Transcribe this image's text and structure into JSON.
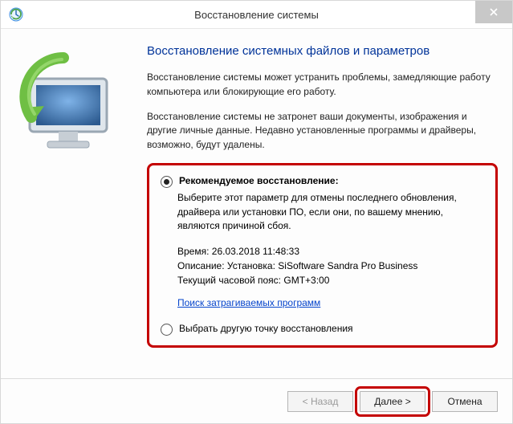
{
  "window": {
    "title": "Восстановление системы"
  },
  "heading": "Восстановление системных файлов и параметров",
  "intro1": "Восстановление системы может устранить проблемы, замедляющие работу компьютера или блокирующие его работу.",
  "intro2": "Восстановление системы не затронет ваши документы, изображения и другие личные данные. Недавно установленные программы и драйверы, возможно, будут удалены.",
  "options": {
    "recommended": {
      "label": "Рекомендуемое восстановление:",
      "desc": "Выберите этот параметр для отмены последнего обновления, драйвера или установки ПО, если они, по вашему мнению, являются причиной сбоя.",
      "time_label": "Время:",
      "time_value": "26.03.2018 11:48:33",
      "desc_label": "Описание:",
      "desc_value": "Установка: SiSoftware Sandra Pro Business",
      "tz_label": "Текущий часовой пояс:",
      "tz_value": "GMT+3:00",
      "link": "Поиск затрагиваемых программ"
    },
    "other": {
      "label": "Выбрать другую точку восстановления"
    }
  },
  "buttons": {
    "back": "< Назад",
    "next": "Далее >",
    "cancel": "Отмена"
  }
}
